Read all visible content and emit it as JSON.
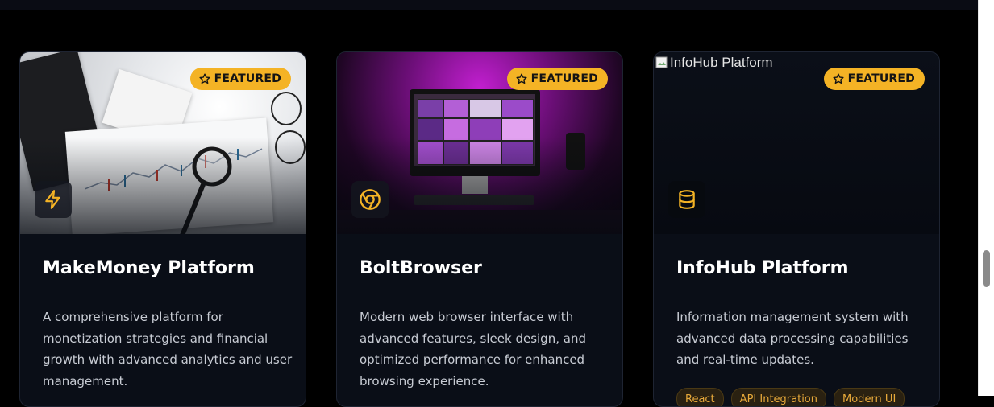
{
  "badge": {
    "label": "FEATURED",
    "icon": "star-icon"
  },
  "colors": {
    "accent": "#f4b325",
    "card_bg": "#0a0e17",
    "page_bg": "#000000"
  },
  "cards": [
    {
      "title": "MakeMoney Platform",
      "description": "A comprehensive platform for monetization strategies and financial growth with advanced analytics and user management.",
      "icon": "lightning-bolt-icon",
      "featured": true
    },
    {
      "title": "BoltBrowser",
      "description": "Modern web browser interface with advanced features, sleek design, and optimized performance for enhanced browsing experience.",
      "icon": "chrome-icon",
      "featured": true
    },
    {
      "title": "InfoHub Platform",
      "description": "Information management system with advanced data processing capabilities and real-time updates.",
      "icon": "database-icon",
      "featured": true,
      "image_alt": "InfoHub Platform",
      "tags": [
        "React",
        "API Integration",
        "Modern UI"
      ]
    }
  ]
}
